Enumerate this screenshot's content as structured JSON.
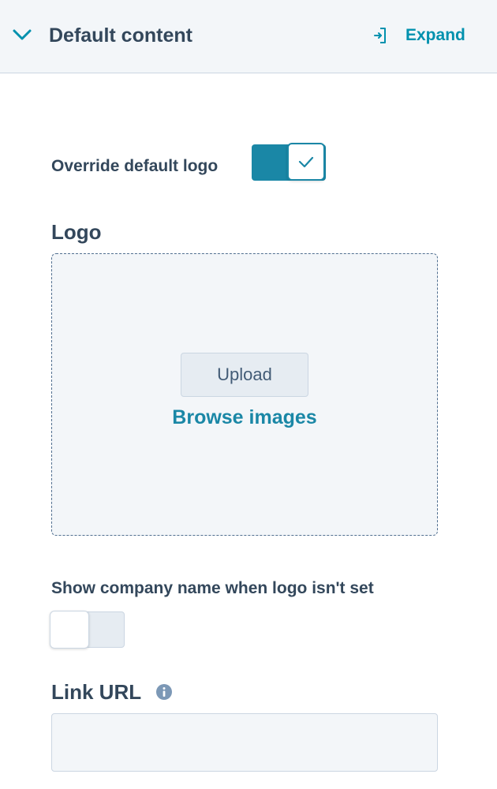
{
  "header": {
    "title": "Default content",
    "expand_label": "Expand",
    "collapse_icon": "chevron-down-icon",
    "expand_icon": "sign-in-icon"
  },
  "override_logo": {
    "label": "Override default logo",
    "enabled": true,
    "check_icon": "check-icon"
  },
  "logo": {
    "label": "Logo",
    "upload_label": "Upload",
    "browse_label": "Browse images"
  },
  "show_company_name": {
    "label": "Show company name when logo isn't set",
    "enabled": false
  },
  "link_url": {
    "label": "Link URL",
    "info_icon": "info-icon",
    "value": "",
    "placeholder": ""
  },
  "colors": {
    "accent": "#1a87a6",
    "link": "#0091ae",
    "text": "#33475b",
    "panel_bg": "#f3f6f9",
    "border": "#cbd6e2"
  }
}
